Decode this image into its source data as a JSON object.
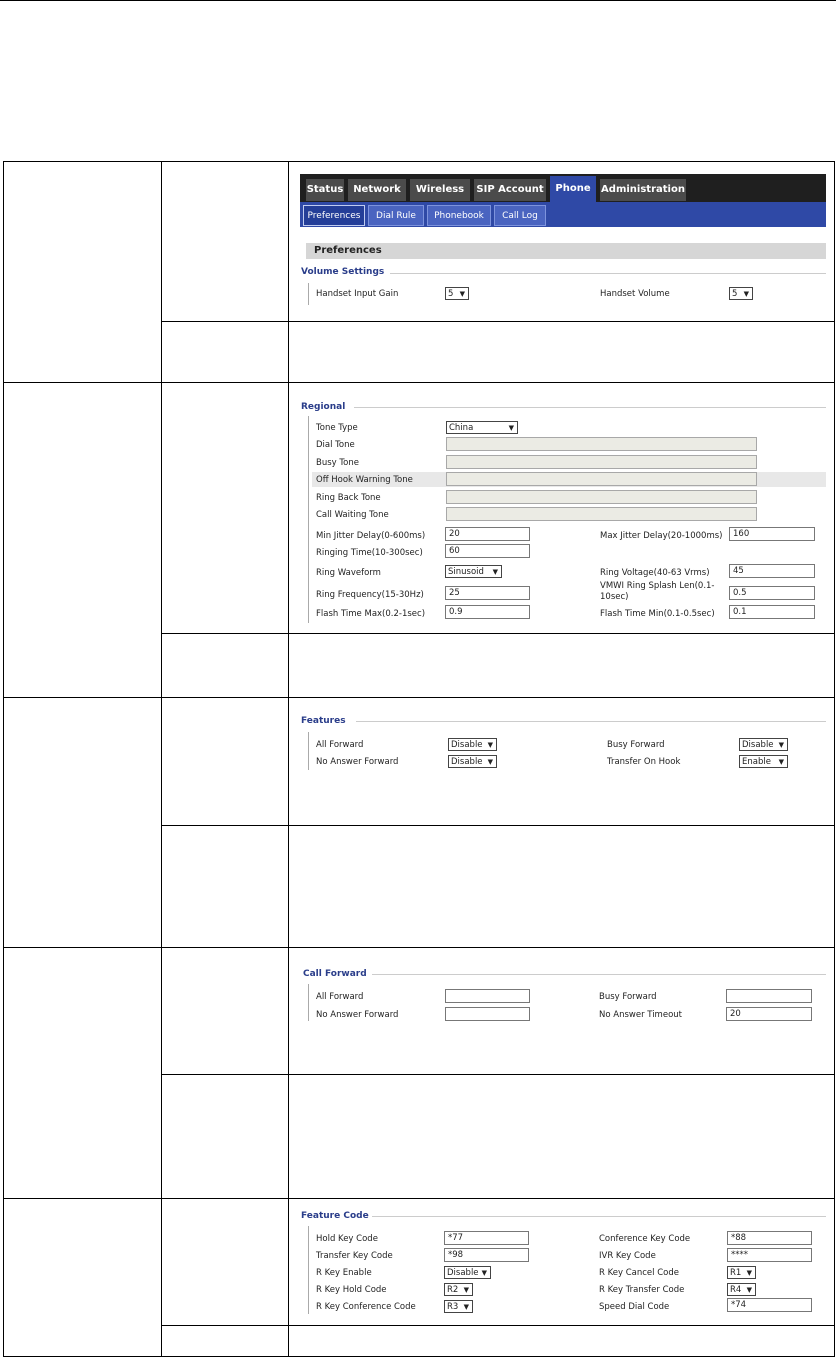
{
  "nav": {
    "main_tabs": [
      "Status",
      "Network",
      "Wireless",
      "SIP Account",
      "Phone",
      "Administration"
    ],
    "active_main": "Phone",
    "sub_tabs": [
      "Preferences",
      "Dial Rule",
      "Phonebook",
      "Call Log"
    ],
    "active_sub": "Preferences"
  },
  "page_title": "Preferences",
  "volume": {
    "section": "Volume Settings",
    "input_gain_label": "Handset Input Gain",
    "input_gain_value": "5",
    "volume_label": "Handset Volume",
    "volume_value": "5"
  },
  "regional": {
    "section": "Regional",
    "tone_type_label": "Tone Type",
    "tone_type_value": "China",
    "dial_tone": "Dial Tone",
    "busy_tone": "Busy Tone",
    "off_hook": "Off Hook Warning Tone",
    "ring_back": "Ring Back Tone",
    "call_waiting": "Call Waiting Tone",
    "min_jitter_label": "Min Jitter Delay(0-600ms)",
    "min_jitter_value": "20",
    "max_jitter_label": "Max Jitter Delay(20-1000ms)",
    "max_jitter_value": "160",
    "ringing_time_label": "Ringing Time(10-300sec)",
    "ringing_time_value": "60",
    "ring_waveform_label": "Ring Waveform",
    "ring_waveform_value": "Sinusoid",
    "ring_voltage_label": "Ring Voltage(40-63 Vrms)",
    "ring_voltage_value": "45",
    "ring_freq_label": "Ring Frequency(15-30Hz)",
    "ring_freq_value": "25",
    "vmwi_label_1": "VMWI Ring Splash Len(0.1-",
    "vmwi_label_2": "10sec)",
    "vmwi_value": "0.5",
    "flash_max_label": "Flash Time Max(0.2-1sec)",
    "flash_max_value": "0.9",
    "flash_min_label": "Flash Time Min(0.1-0.5sec)",
    "flash_min_value": "0.1"
  },
  "features": {
    "section": "Features",
    "all_forward_label": "All Forward",
    "all_forward_value": "Disable",
    "busy_forward_label": "Busy Forward",
    "busy_forward_value": "Disable",
    "no_answer_label": "No Answer Forward",
    "no_answer_value": "Disable",
    "transfer_label": "Transfer On Hook",
    "transfer_value": "Enable"
  },
  "call_forward": {
    "section": "Call Forward",
    "all_forward_label": "All Forward",
    "all_forward_value": "",
    "busy_forward_label": "Busy Forward",
    "busy_forward_value": "",
    "no_answer_label": "No Answer Forward",
    "no_answer_value": "",
    "timeout_label": "No Answer Timeout",
    "timeout_value": "20"
  },
  "feature_code": {
    "section": "Feature Code",
    "hold_label": "Hold Key Code",
    "hold_value": "*77",
    "conf_label": "Conference Key Code",
    "conf_value": "*88",
    "transfer_label": "Transfer Key Code",
    "transfer_value": "*98",
    "ivr_label": "IVR Key Code",
    "ivr_value": "****",
    "rkey_enable_label": "R Key Enable",
    "rkey_enable_value": "Disable",
    "rkey_cancel_label": "R Key Cancel Code",
    "rkey_cancel_value": "R1",
    "rkey_hold_label": "R Key Hold Code",
    "rkey_hold_value": "R2",
    "rkey_transfer_label": "R Key Transfer Code",
    "rkey_transfer_value": "R4",
    "rkey_conf_label": "R Key Conference Code",
    "rkey_conf_value": "R3",
    "speed_dial_label": "Speed Dial Code",
    "speed_dial_value": "*74"
  }
}
